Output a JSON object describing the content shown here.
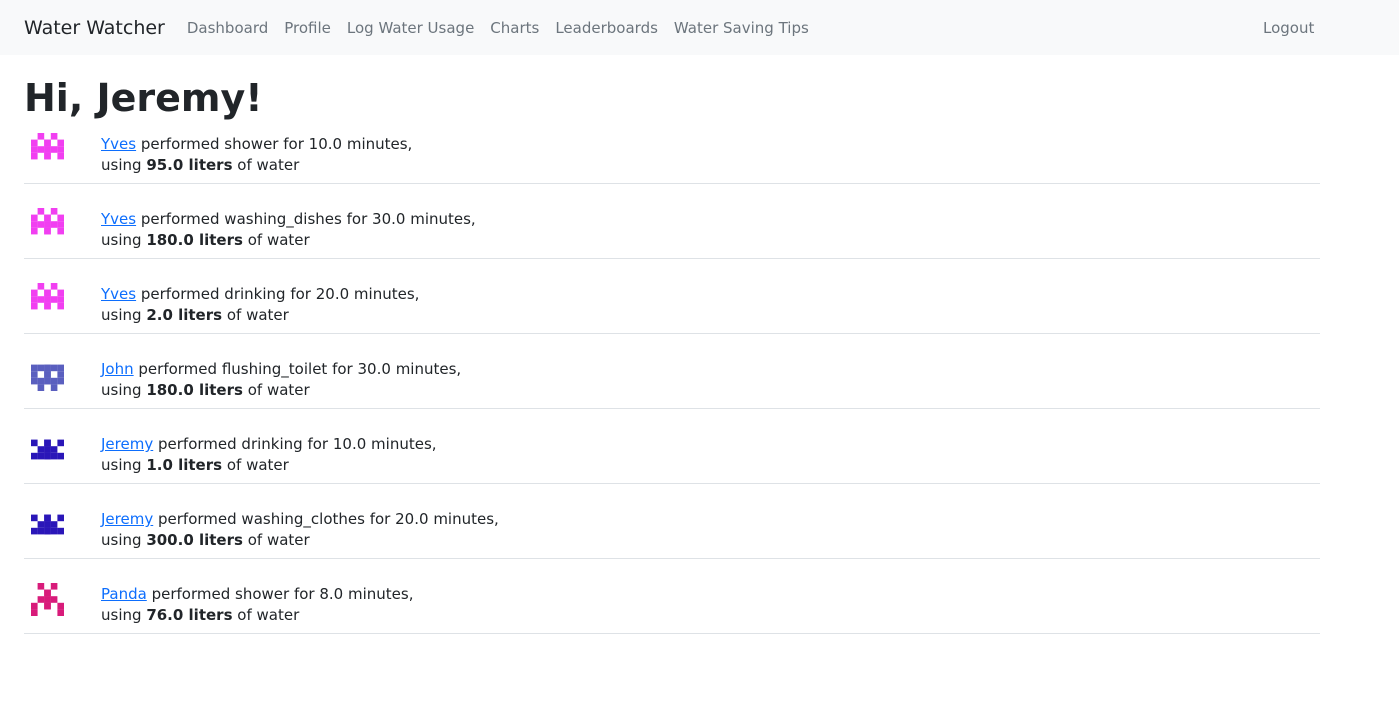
{
  "nav": {
    "brand": "Water Watcher",
    "links": [
      "Dashboard",
      "Profile",
      "Log Water Usage",
      "Charts",
      "Leaderboards",
      "Water Saving Tips"
    ],
    "logout": "Logout"
  },
  "greeting": "Hi, Jeremy!",
  "text": {
    "performed": "performed",
    "for": "for",
    "minutes_suffix": "minutes,",
    "using": "using",
    "of_water": "of water"
  },
  "feed": [
    {
      "user": "Yves",
      "activity": "shower",
      "minutes": "10.0",
      "liters": "95.0 liters",
      "avatar_color": "#f13ff1",
      "avatar_icon": "yves-identicon"
    },
    {
      "user": "Yves",
      "activity": "washing_dishes",
      "minutes": "30.0",
      "liters": "180.0 liters",
      "avatar_color": "#f13ff1",
      "avatar_icon": "yves-identicon"
    },
    {
      "user": "Yves",
      "activity": "drinking",
      "minutes": "20.0",
      "liters": "2.0 liters",
      "avatar_color": "#f13ff1",
      "avatar_icon": "yves-identicon"
    },
    {
      "user": "John",
      "activity": "flushing_toilet",
      "minutes": "30.0",
      "liters": "180.0 liters",
      "avatar_color": "#5a5fbf",
      "avatar_icon": "john-identicon"
    },
    {
      "user": "Jeremy",
      "activity": "drinking",
      "minutes": "10.0",
      "liters": "1.0 liters",
      "avatar_color": "#2a16b8",
      "avatar_icon": "jeremy-identicon"
    },
    {
      "user": "Jeremy",
      "activity": "washing_clothes",
      "minutes": "20.0",
      "liters": "300.0 liters",
      "avatar_color": "#2a16b8",
      "avatar_icon": "jeremy-identicon"
    },
    {
      "user": "Panda",
      "activity": "shower",
      "minutes": "8.0",
      "liters": "76.0 liters",
      "avatar_color": "#d81b7a",
      "avatar_icon": "panda-identicon"
    }
  ]
}
